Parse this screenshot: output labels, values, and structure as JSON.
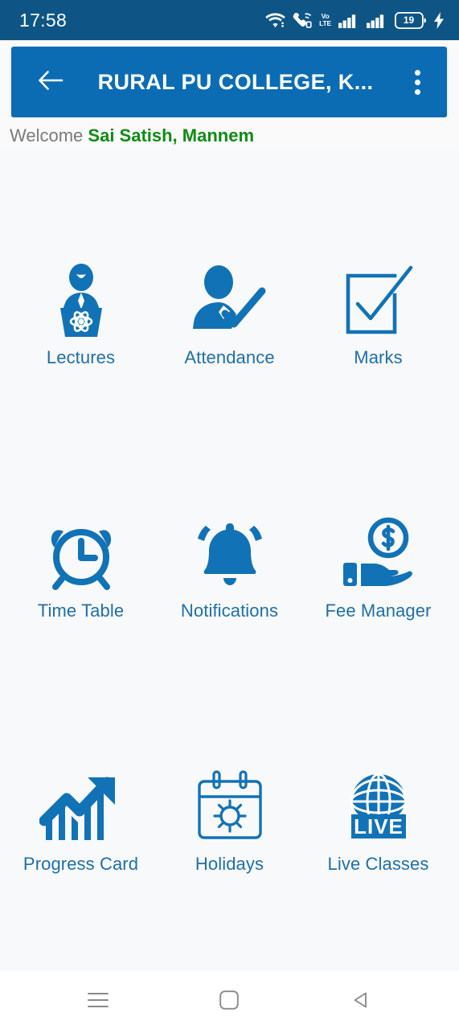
{
  "status_bar": {
    "time": "17:58",
    "battery_level": "19",
    "volte_line1": "Vo",
    "volte_line2": "LTE",
    "icons": [
      "wifi-icon",
      "call-wifi-icon",
      "volte-icon",
      "signal-bars-sim1-icon",
      "signal-bars-sim2-icon",
      "battery-icon",
      "charging-bolt-icon"
    ]
  },
  "app_bar": {
    "title": "RURAL PU COLLEGE, K...",
    "back_icon": "arrow-left-icon",
    "overflow_icon": "more-vertical-icon",
    "background_color": "#0b6cb4"
  },
  "welcome": {
    "label": "Welcome ",
    "user_name": "Sai Satish, Mannem",
    "label_color": "#7a7a7a",
    "name_color": "#108a16"
  },
  "grid": {
    "accent_color": "#1f6fa8",
    "rows": [
      [
        {
          "label": "Lectures",
          "icon": "lecturer-podium-icon"
        },
        {
          "label": "Attendance",
          "icon": "person-check-icon"
        },
        {
          "label": "Marks",
          "icon": "checkbox-tick-icon"
        }
      ],
      [
        {
          "label": "Time Table",
          "icon": "alarm-clock-icon"
        },
        {
          "label": "Notifications",
          "icon": "bell-icon"
        },
        {
          "label": "Fee Manager",
          "icon": "hand-coin-icon"
        }
      ],
      [
        {
          "label": "Progress Card",
          "icon": "growth-chart-icon"
        },
        {
          "label": "Holidays",
          "icon": "calendar-sun-icon"
        },
        {
          "label": "Live Classes",
          "icon": "globe-live-icon"
        }
      ]
    ]
  },
  "nav_bar": {
    "items": [
      {
        "name": "recents",
        "icon": "menu-lines-icon"
      },
      {
        "name": "home",
        "icon": "rounded-square-icon"
      },
      {
        "name": "back",
        "icon": "triangle-back-icon"
      }
    ]
  }
}
